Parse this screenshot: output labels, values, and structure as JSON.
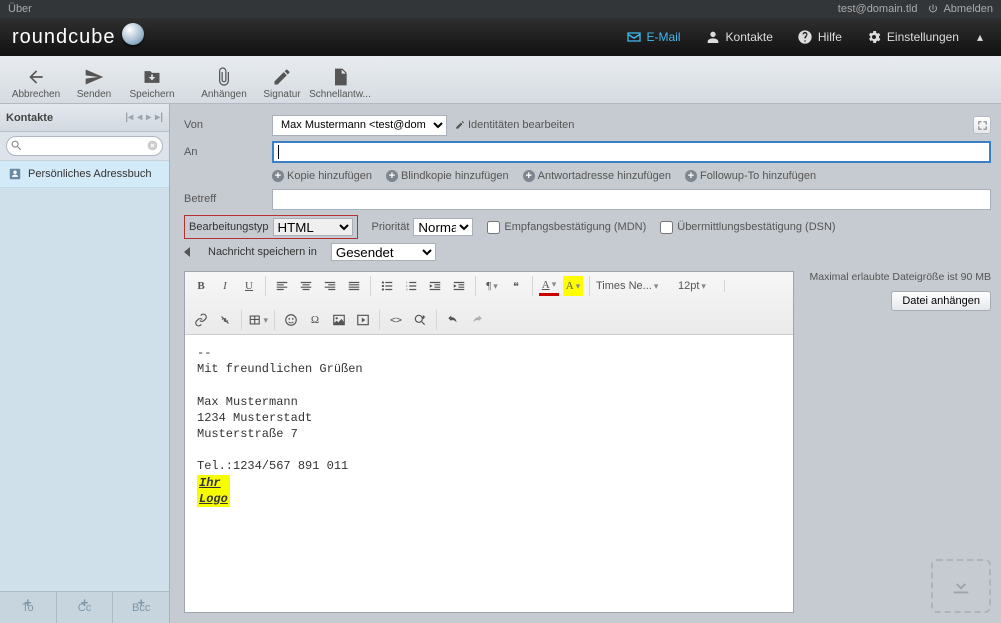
{
  "topstrip": {
    "about": "Über",
    "user": "test@domain.tld",
    "logout": "Abmelden"
  },
  "nav": {
    "mail": "E-Mail",
    "contacts": "Kontakte",
    "help": "Hilfe",
    "settings": "Einstellungen"
  },
  "toolbar": {
    "cancel": "Abbrechen",
    "send": "Senden",
    "save": "Speichern",
    "attach": "Anhängen",
    "signature": "Signatur",
    "responses": "Schnellantw..."
  },
  "sidebar": {
    "title": "Kontakte",
    "search_placeholder": "",
    "addressbook": "Persönliches Adressbuch",
    "to": "To",
    "cc": "Cc",
    "bcc": "Bcc"
  },
  "compose": {
    "from_label": "Von",
    "from_value": "Max Mustermann <test@domain.tld>",
    "edit_identities": "Identitäten bearbeiten",
    "to_label": "An",
    "add_cc": "Kopie hinzufügen",
    "add_bcc": "Blindkopie hinzufügen",
    "add_replyto": "Antwortadresse hinzufügen",
    "add_followup": "Followup-To hinzufügen",
    "subject_label": "Betreff",
    "editor_type_label": "Bearbeitungstyp",
    "editor_type_value": "HTML",
    "priority_label": "Priorität",
    "priority_value": "Normal",
    "mdn": "Empfangsbestätigung (MDN)",
    "dsn": "Übermittlungsbestätigung (DSN)",
    "save_in_label": "Nachricht speichern in",
    "save_in_value": "Gesendet",
    "font_name": "Times Ne...",
    "font_size": "12pt"
  },
  "body": {
    "sig_sep": "--",
    "greeting": "Mit freundlichen Grüßen",
    "name": "Max Mustermann",
    "city": "1234 Musterstadt",
    "street": "Musterstraße 7",
    "tel": "Tel.:1234/567 891 011",
    "logo1": "Ihr",
    "logo2": "Logo"
  },
  "attach": {
    "limit": "Maximal erlaubte Dateigröße ist 90 MB",
    "button": "Datei anhängen"
  },
  "logo": "roundcube"
}
